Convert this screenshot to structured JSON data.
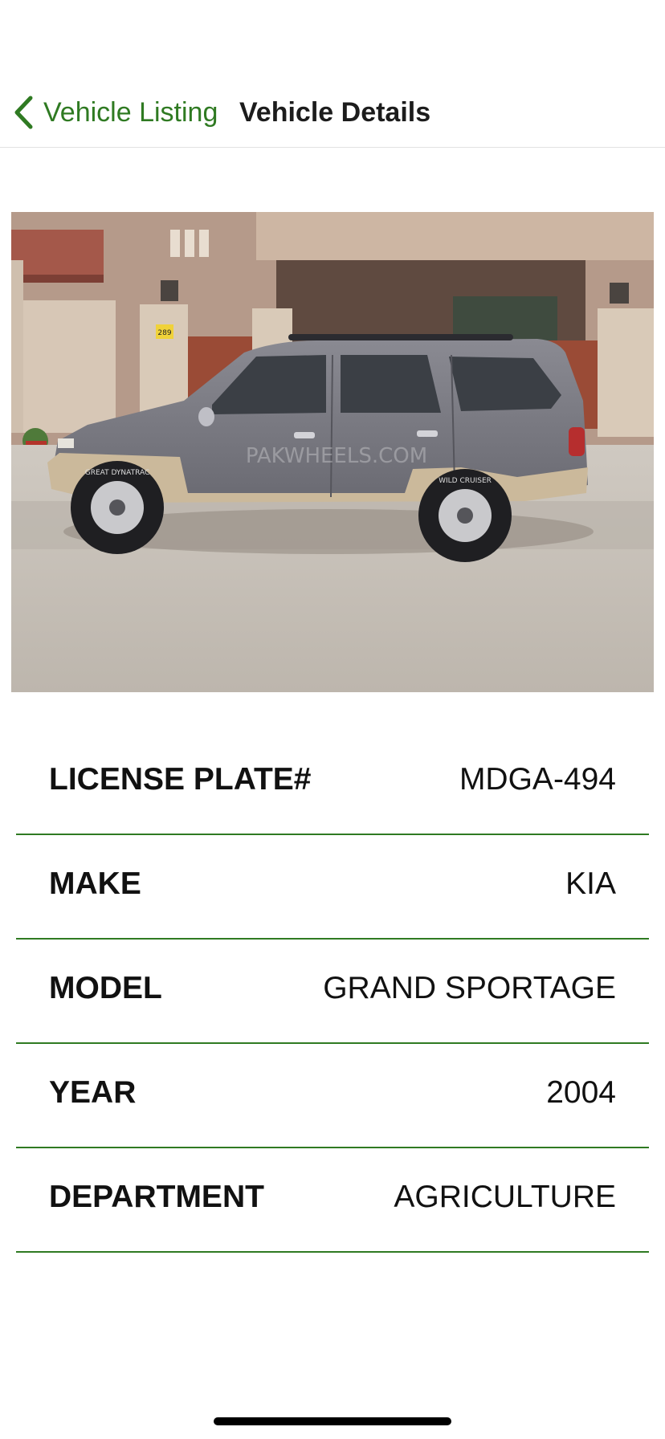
{
  "nav": {
    "back_label": "Vehicle Listing",
    "title": "Vehicle Details",
    "accent_color": "#2f7a22"
  },
  "photo": {
    "watermark": "PAKWHEELS.COM",
    "house_number": "289",
    "tire_text_front": "GREAT DYNATRAC",
    "tire_text_rear": "WILD CRUISER"
  },
  "details": [
    {
      "label": "LICENSE PLATE#",
      "value": "MDGA-494"
    },
    {
      "label": "MAKE",
      "value": "KIA"
    },
    {
      "label": "MODEL",
      "value": "GRAND SPORTAGE"
    },
    {
      "label": "YEAR",
      "value": "2004"
    },
    {
      "label": "DEPARTMENT",
      "value": "AGRICULTURE"
    }
  ]
}
